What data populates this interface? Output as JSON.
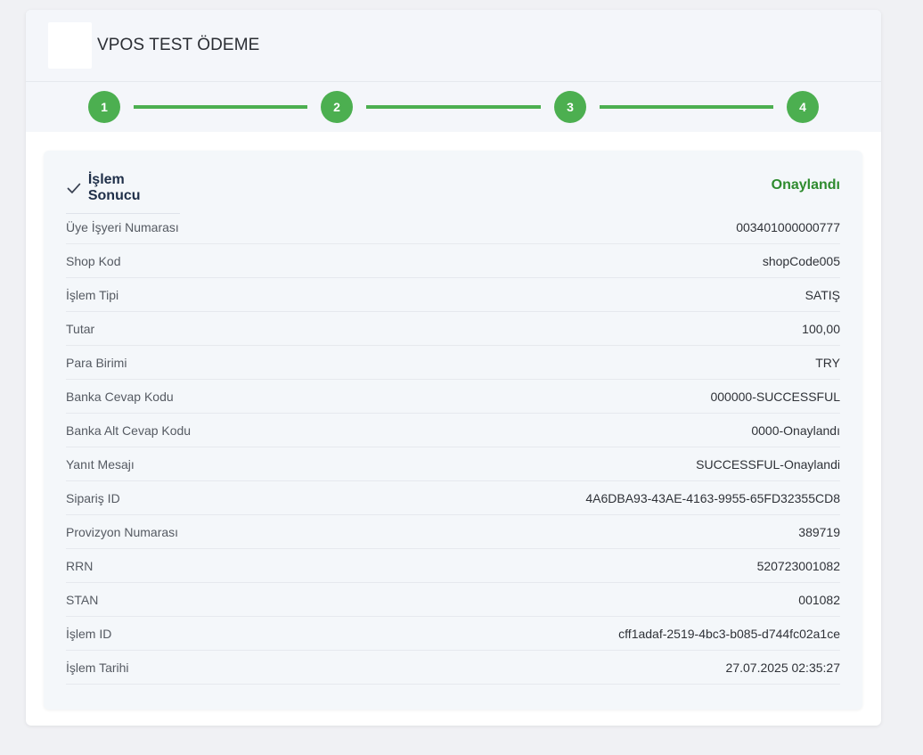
{
  "header": {
    "title": "VPOS TEST ÖDEME"
  },
  "stepper": {
    "steps": [
      "1",
      "2",
      "3",
      "4"
    ],
    "color": "#4caf50"
  },
  "result": {
    "title": "İşlem Sonucu",
    "status": "Onaylandı",
    "status_color": "#2e8b2e",
    "rows": [
      {
        "label": "Üye İşyeri Numarası",
        "value": "003401000000777"
      },
      {
        "label": "Shop Kod",
        "value": "shopCode005"
      },
      {
        "label": "İşlem Tipi",
        "value": "SATIŞ"
      },
      {
        "label": "Tutar",
        "value": "100,00"
      },
      {
        "label": "Para Birimi",
        "value": "TRY"
      },
      {
        "label": "Banka Cevap Kodu",
        "value": "000000-SUCCESSFUL"
      },
      {
        "label": "Banka Alt Cevap Kodu",
        "value": "0000-Onaylandı"
      },
      {
        "label": "Yanıt Mesajı",
        "value": "SUCCESSFUL-Onaylandi"
      },
      {
        "label": "Sipariş ID",
        "value": "4A6DBA93-43AE-4163-9955-65FD32355CD8"
      },
      {
        "label": "Provizyon Numarası",
        "value": "389719"
      },
      {
        "label": "RRN",
        "value": "520723001082"
      },
      {
        "label": "STAN",
        "value": "001082"
      },
      {
        "label": "İşlem ID",
        "value": "cff1adaf-2519-4bc3-b085-d744fc02a1ce"
      },
      {
        "label": "İşlem Tarihi",
        "value": "27.07.2025 02:35:27"
      }
    ]
  },
  "icons": {
    "check": "check-icon"
  }
}
